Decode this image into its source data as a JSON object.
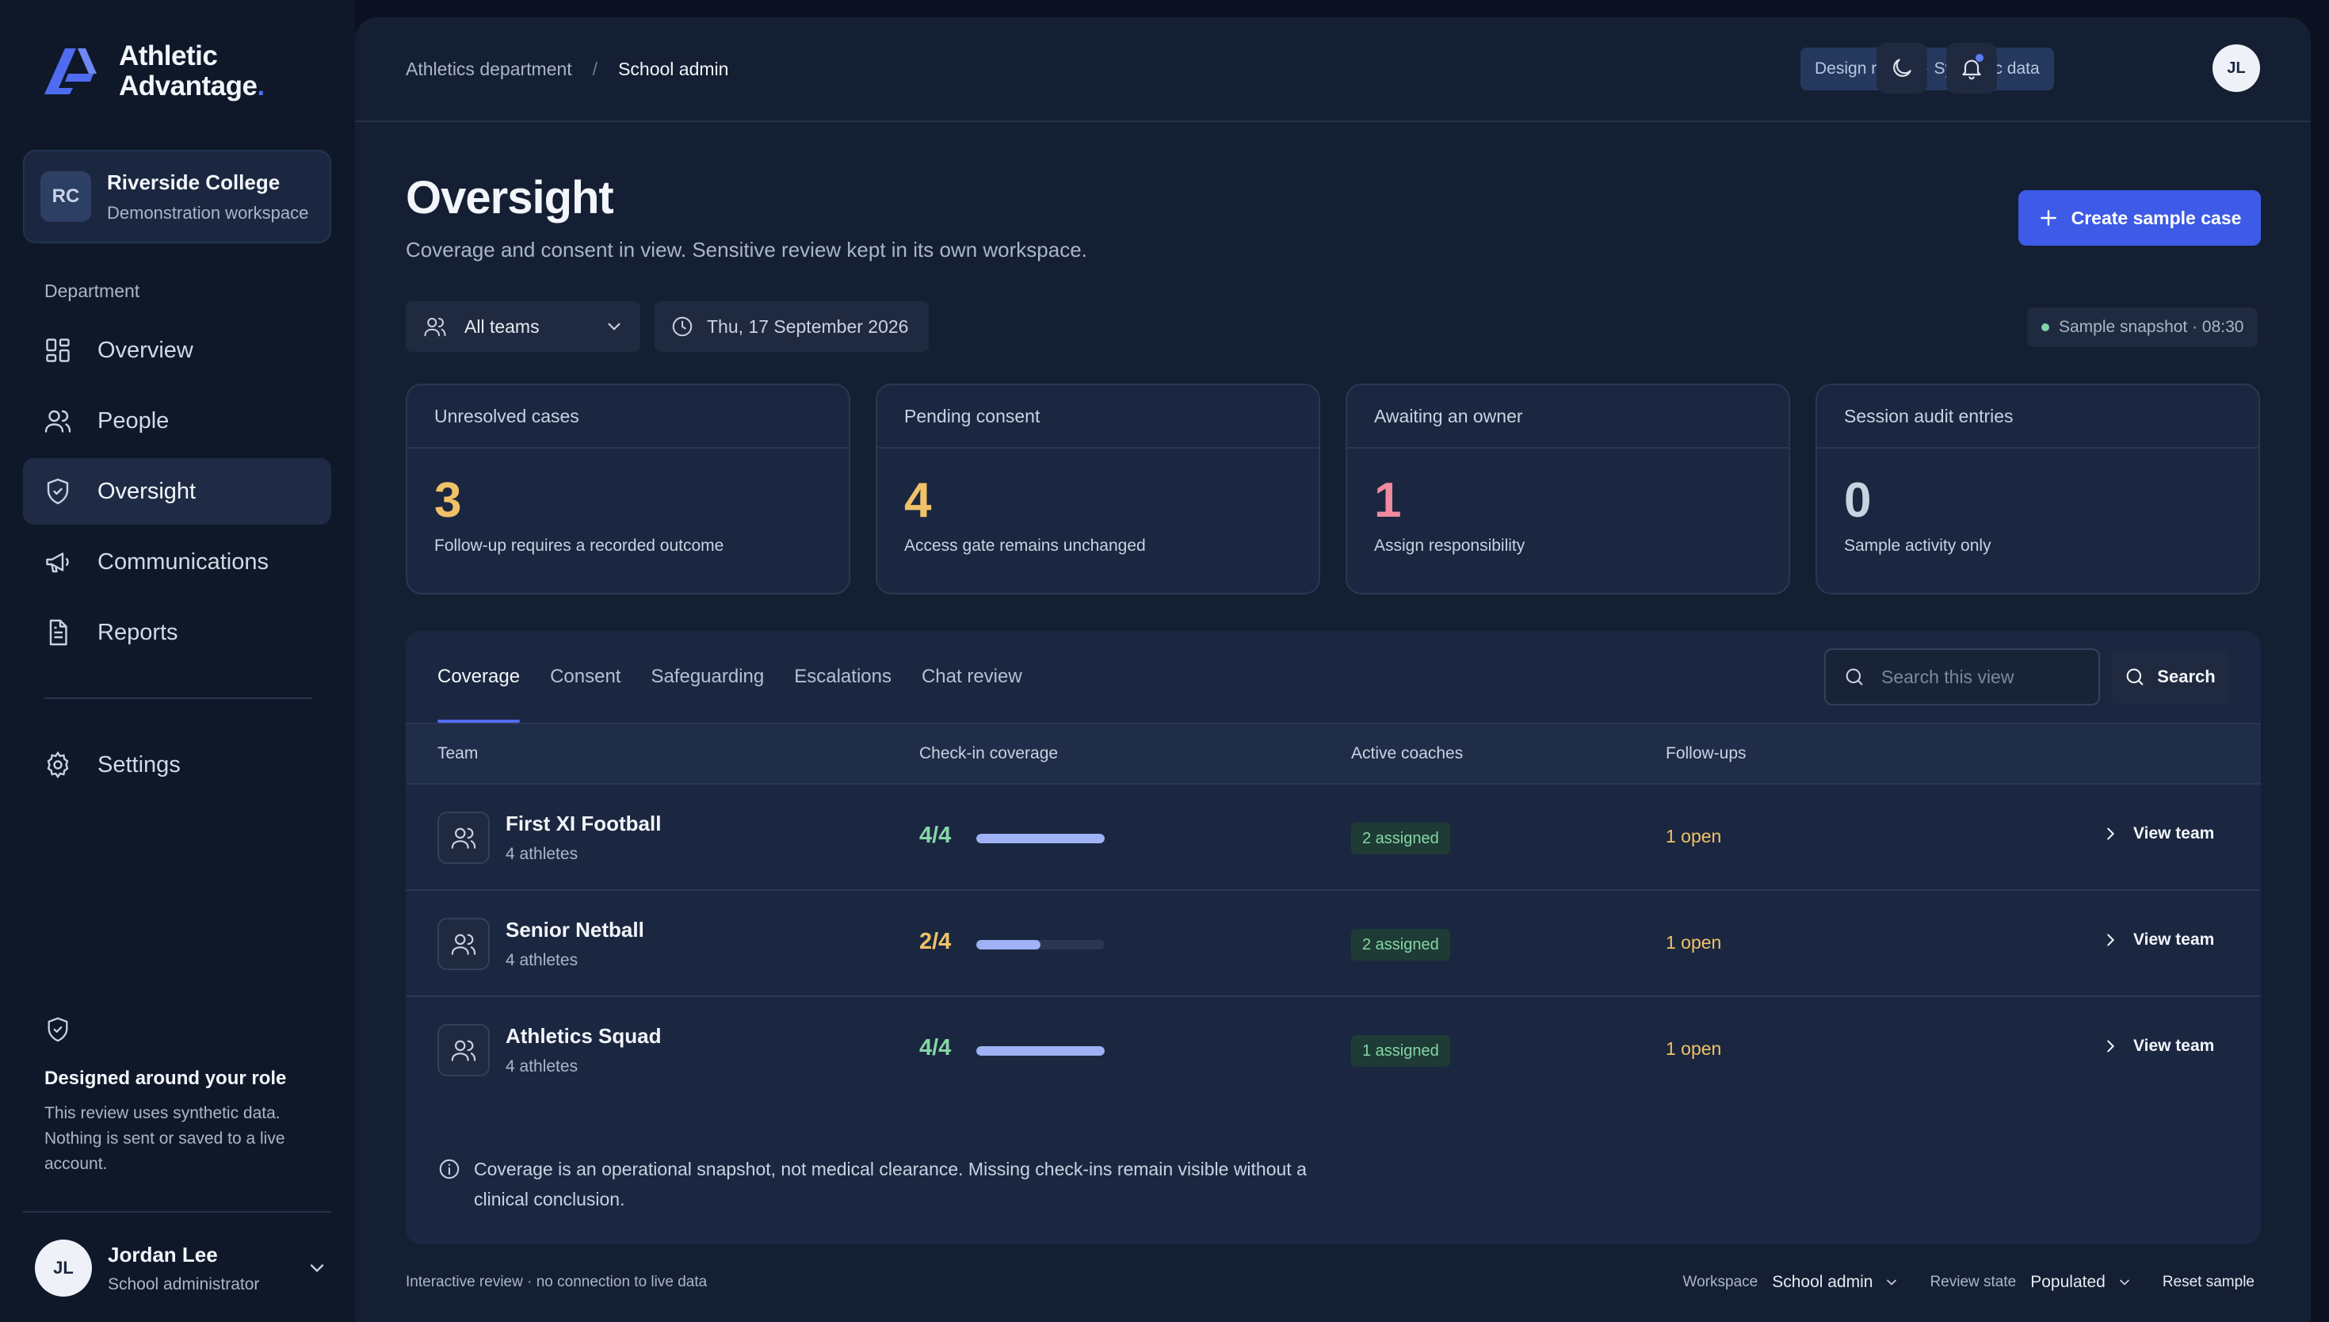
{
  "brand": {
    "line1": "Athletic",
    "line2": "Advantage",
    "dot": "."
  },
  "workspace": {
    "initials": "RC",
    "name": "Riverside College",
    "subtitle": "Demonstration workspace"
  },
  "nav": {
    "section": "Department",
    "items": [
      {
        "label": "Overview",
        "icon": "grid-icon"
      },
      {
        "label": "People",
        "icon": "people-icon"
      },
      {
        "label": "Oversight",
        "icon": "shield-icon",
        "active": true
      },
      {
        "label": "Communications",
        "icon": "megaphone-icon"
      },
      {
        "label": "Reports",
        "icon": "document-icon"
      }
    ],
    "settings": "Settings"
  },
  "role_card": {
    "title": "Designed around your role",
    "body": "This review uses synthetic data. Nothing is sent or saved to a live account."
  },
  "user": {
    "initials": "JL",
    "name": "Jordan Lee",
    "role": "School administrator"
  },
  "topbar": {
    "crumb1": "Athletics department",
    "crumb_sep": "/",
    "crumb2": "School admin",
    "tag": "Design review · Synthetic data",
    "avatar": "JL"
  },
  "page": {
    "title": "Oversight",
    "subtitle": "Coverage and consent in view. Sensitive review kept in its own workspace.",
    "create_button": "Create sample case",
    "team_filter": "All teams",
    "date": "Thu, 17 September 2026",
    "snapshot": "Sample snapshot · 08:30"
  },
  "kpis": [
    {
      "label": "Unresolved cases",
      "value": "3",
      "sub": "Follow-up requires a recorded outcome",
      "color": "#f0c267"
    },
    {
      "label": "Pending consent",
      "value": "4",
      "sub": "Access gate remains unchanged",
      "color": "#f0c267"
    },
    {
      "label": "Awaiting an owner",
      "value": "1",
      "sub": "Assign responsibility",
      "color": "#f08aa0"
    },
    {
      "label": "Session audit entries",
      "value": "0",
      "sub": "Sample activity only",
      "color": "#c9d2e2"
    }
  ],
  "tabs": [
    "Coverage",
    "Consent",
    "Safeguarding",
    "Escalations",
    "Chat review"
  ],
  "search": {
    "placeholder": "Search this view",
    "button": "Search"
  },
  "table": {
    "headers": {
      "team": "Team",
      "coverage": "Check-in coverage",
      "coaches": "Active coaches",
      "followups": "Follow-ups"
    },
    "rows": [
      {
        "team": "First XI Football",
        "athletes": "4 athletes",
        "coverage": "4/4",
        "coverage_fraction": 1.0,
        "coverage_color": "#86d6a6",
        "coaches": "2 assigned",
        "followups": "1 open",
        "action": "View team"
      },
      {
        "team": "Senior Netball",
        "athletes": "4 athletes",
        "coverage": "2/4",
        "coverage_fraction": 0.5,
        "coverage_color": "#f0c267",
        "coaches": "2 assigned",
        "followups": "1 open",
        "action": "View team"
      },
      {
        "team": "Athletics Squad",
        "athletes": "4 athletes",
        "coverage": "4/4",
        "coverage_fraction": 1.0,
        "coverage_color": "#86d6a6",
        "coaches": "1 assigned",
        "followups": "1 open",
        "action": "View team"
      }
    ],
    "note": "Coverage is an operational snapshot, not medical clearance. Missing check-ins remain visible without a clinical conclusion."
  },
  "footer": {
    "left": "Interactive review · no connection to live data",
    "workspace_label": "Workspace",
    "workspace_value": "School admin",
    "state_label": "Review state",
    "state_value": "Populated",
    "reset": "Reset sample"
  }
}
